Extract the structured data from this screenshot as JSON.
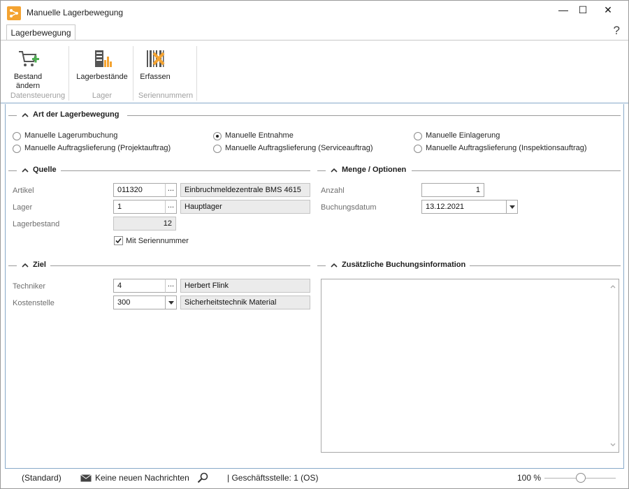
{
  "window": {
    "title": "Manuelle Lagerbewegung",
    "minimize": "—",
    "maximize": "☐",
    "close": "✕",
    "help": "?"
  },
  "ribbon": {
    "tab": "Lagerbewegung",
    "groups": [
      {
        "label": "Datensteuerung",
        "buttons": [
          {
            "label_line1": "Bestand",
            "label_line2": "ändern",
            "icon": "cart-add-icon"
          }
        ]
      },
      {
        "label": "Lager",
        "buttons": [
          {
            "label": "Lagerbestände",
            "icon": "inventory-icon"
          }
        ]
      },
      {
        "label": "Seriennummern",
        "buttons": [
          {
            "label": "Erfassen",
            "icon": "barcode-edit-icon"
          }
        ]
      }
    ]
  },
  "art": {
    "title": "Art der Lagerbewegung",
    "options": [
      {
        "label": "Manuelle Lagerumbuchung",
        "selected": false
      },
      {
        "label": "Manuelle Entnahme",
        "selected": true
      },
      {
        "label": "Manuelle Einlagerung",
        "selected": false
      },
      {
        "label": "Manuelle Auftragslieferung (Projektauftrag)",
        "selected": false
      },
      {
        "label": "Manuelle Auftragslieferung (Serviceauftrag)",
        "selected": false
      },
      {
        "label": "Manuelle Auftragslieferung (Inspektionsauftrag)",
        "selected": false
      }
    ]
  },
  "quelle": {
    "title": "Quelle",
    "artikel_label": "Artikel",
    "artikel_value": "011320",
    "artikel_desc": "Einbruchmeldezentrale BMS 4615",
    "lager_label": "Lager",
    "lager_value": "1",
    "lager_desc": "Hauptlager",
    "bestand_label": "Lagerbestand",
    "bestand_value": "12",
    "serien_label": "Mit Seriennummer",
    "serien_checked": true,
    "ellipsis": "..."
  },
  "menge": {
    "title": "Menge / Optionen",
    "anzahl_label": "Anzahl",
    "anzahl_value": "1",
    "datum_label": "Buchungsdatum",
    "datum_value": "13.12.2021"
  },
  "ziel": {
    "title": "Ziel",
    "techniker_label": "Techniker",
    "techniker_value": "4",
    "techniker_desc": "Herbert Flink",
    "kostenstelle_label": "Kostenstelle",
    "kostenstelle_value": "300",
    "kostenstelle_desc": "Sicherheitstechnik Material"
  },
  "zusatz": {
    "title": "Zusätzliche Buchungsinformation",
    "value": ""
  },
  "status": {
    "profile": "(Standard)",
    "messages": "Keine neuen Nachrichten",
    "branch": "| Geschäftsstelle:  1 (OS)",
    "zoom": "100 %",
    "zoom_level_percent": 50
  },
  "colors": {
    "accent": "#f4a331",
    "border_blue": "#87a9c9",
    "readonly_bg": "#ebebeb"
  }
}
